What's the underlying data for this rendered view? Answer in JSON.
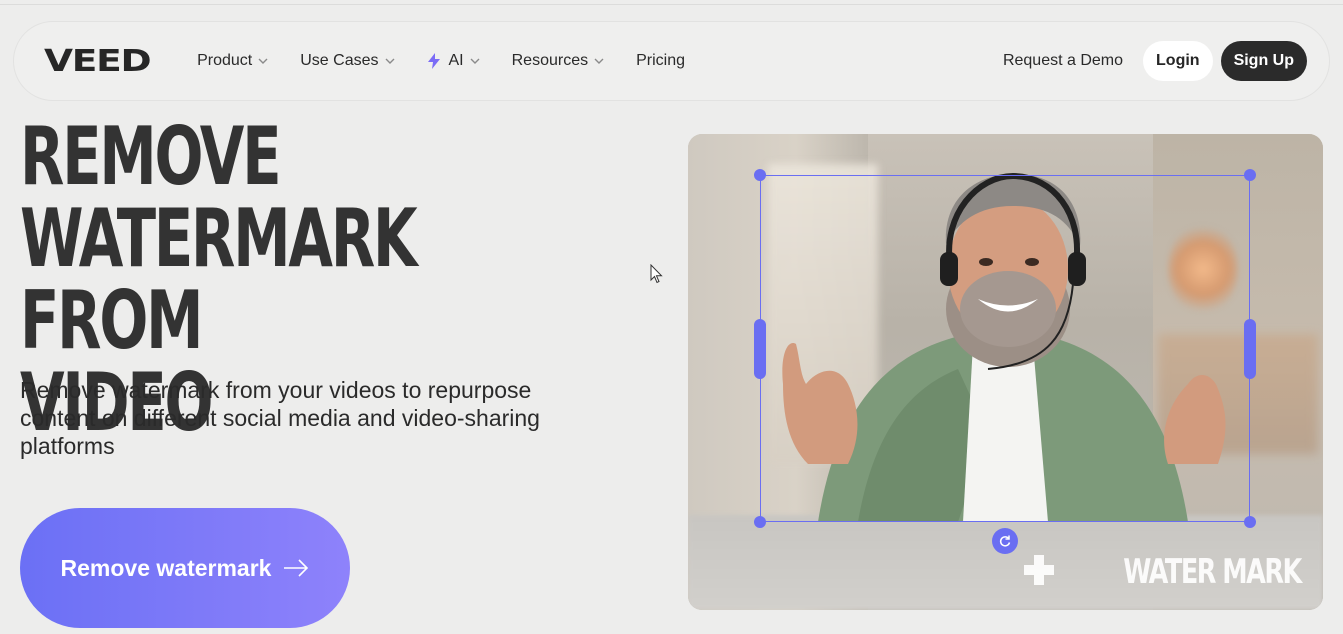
{
  "nav": {
    "logo": "VEED",
    "items": [
      {
        "label": "Product",
        "has_dropdown": true
      },
      {
        "label": "Use Cases",
        "has_dropdown": true
      },
      {
        "label": "AI",
        "has_dropdown": true,
        "icon": "lightning-bolt-icon"
      },
      {
        "label": "Resources",
        "has_dropdown": true
      },
      {
        "label": "Pricing",
        "has_dropdown": false
      }
    ],
    "request_demo": "Request a Demo",
    "login": "Login",
    "signup": "Sign Up"
  },
  "hero": {
    "title_lines": [
      "REMOVE",
      "WATERMARK FROM",
      "VIDEO"
    ],
    "subtitle": "Remove watermark from your videos to repurpose content on different social media and video-sharing platforms",
    "cta_label": "Remove watermark",
    "cta_icon": "arrow-right-icon"
  },
  "video": {
    "watermark_text": "WATER MARK",
    "watermark_icon": "plus-cross-icon",
    "rotate_icon": "rotate-icon"
  },
  "colors": {
    "background": "#ededec",
    "accent": "#6a6ef2",
    "cta_gradient_start": "#6b70f5",
    "cta_gradient_end": "#8e82fb",
    "signup_bg": "#2b2b2b",
    "ai_bolt": "#7b6cf6"
  }
}
